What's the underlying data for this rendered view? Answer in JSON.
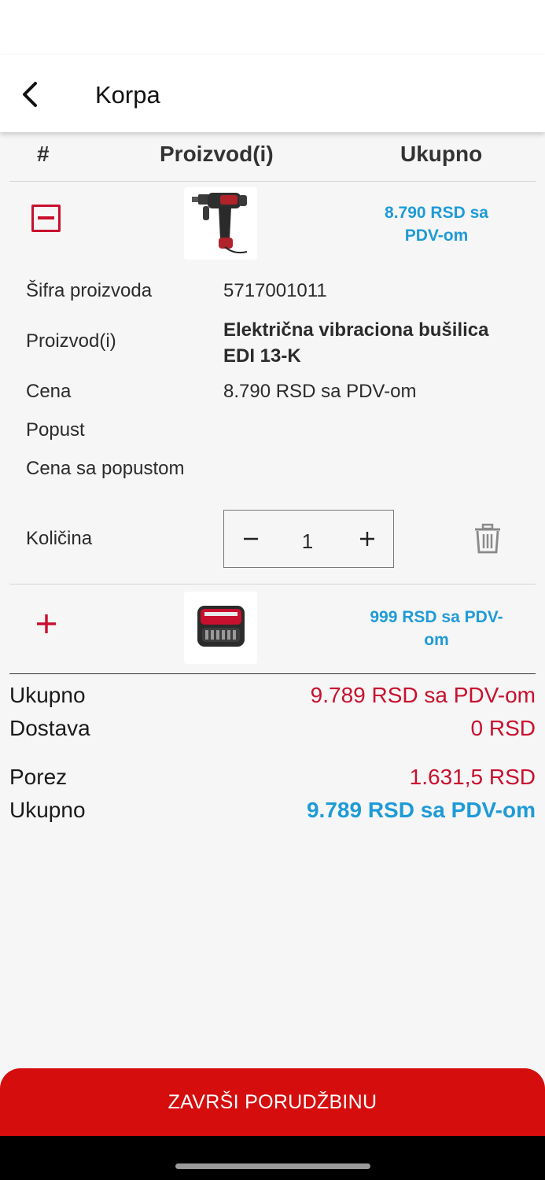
{
  "app_bar": {
    "title": "Korpa"
  },
  "table_header": {
    "hash": "#",
    "product": "Proizvod(i)",
    "total": "Ukupno"
  },
  "items": [
    {
      "thumbnail": "power-drill-image",
      "total_line1": "8.790 RSD sa",
      "total_line2": "PDV-om",
      "expanded": true,
      "details": {
        "sku_label": "Šifra proizvoda",
        "sku_value": "5717001011",
        "product_label": "Proizvod(i)",
        "product_line1": "Električna vibraciona bušilica",
        "product_line2": "EDI 13-K",
        "price_label": "Cena",
        "price_value": "8.790 RSD sa PDV-om",
        "discount_label": "Popust",
        "discounted_label": "Cena sa popustom",
        "quantity_label": "Količina",
        "quantity_value": "1"
      }
    },
    {
      "thumbnail": "wurth-bit-set-image",
      "total_line1": "999 RSD sa PDV-",
      "total_line2": "om",
      "expanded": false
    }
  ],
  "summary": {
    "subtotal_label": "Ukupno",
    "subtotal_value": "9.789 RSD sa PDV-om",
    "shipping_label": "Dostava",
    "shipping_value": "0 RSD",
    "tax_label": "Porez",
    "tax_value": "1.631,5 RSD",
    "total_label": "Ukupno",
    "total_value": "9.789 RSD sa PDV-om"
  },
  "checkout": {
    "label": "ZAVRŠI PORUDŽBINU"
  },
  "colors": {
    "accent_red": "#c8102e",
    "button_red": "#d50d0d",
    "price_blue": "#1e9bd7"
  }
}
